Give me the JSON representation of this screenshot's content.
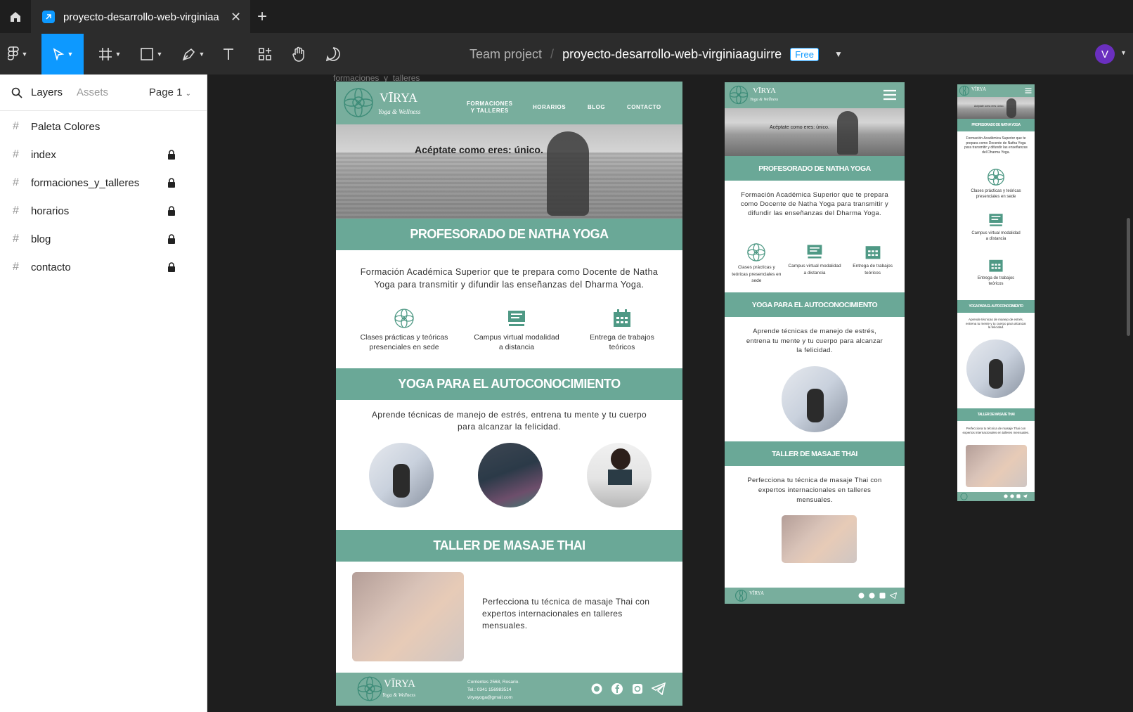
{
  "tabbar": {
    "tab_title": "proyecto-desarrollo-web-virginiaa",
    "close": "✕",
    "new_tab": "+"
  },
  "toolbar": {
    "team": "Team project",
    "separator": "/",
    "project": "proyecto-desarrollo-web-virginiaaguirre",
    "plan_badge": "Free",
    "avatar_letter": "V"
  },
  "left_panel": {
    "tabs": {
      "layers": "Layers",
      "assets": "Assets"
    },
    "page_selector": "Page 1",
    "layers": [
      {
        "name": "Paleta Colores",
        "locked": false
      },
      {
        "name": "index",
        "locked": true
      },
      {
        "name": "formaciones_y_talleres",
        "locked": true
      },
      {
        "name": "horarios",
        "locked": true
      },
      {
        "name": "blog",
        "locked": true
      },
      {
        "name": "contacto",
        "locked": true
      }
    ]
  },
  "canvas": {
    "frame_label": "formaciones_y_talleres",
    "desktop": {
      "brand": "VĪRYA",
      "brand_sub": "Yoga & Wellness",
      "nav": [
        "FORMACIONES\nY TALLERES",
        "HORARIOS",
        "BLOG",
        "CONTACTO"
      ],
      "hero_text": "Acéptate como eres: único.",
      "section1_title": "PROFESORADO DE NATHA YOGA",
      "section1_body": "Formación Académica Superior que te prepara como Docente de Natha Yoga para transmitir y difundir las enseñanzas del Dharma Yoga.",
      "features": [
        {
          "label": "Clases prácticas y teóricas presenciales en sede",
          "icon": "mandala-icon"
        },
        {
          "label": "Campus virtual modalidad a distancia",
          "icon": "monitor-icon"
        },
        {
          "label": "Entrega de trabajos teóricos",
          "icon": "calendar-icon"
        }
      ],
      "section2_title": "YOGA PARA EL AUTOCONOCIMIENTO",
      "section2_body": "Aprende técnicas de manejo de estrés, entrena tu mente y tu cuerpo para alcanzar la felicidad.",
      "section3_title": "TALLER DE MASAJE THAI",
      "section3_body": "Perfecciona tu técnica de masaje Thai con expertos internacionales en talleres mensuales.",
      "footer_address": "Corrientes 2568, Rosario.",
      "footer_phone": "Tel.: 0341 156983514",
      "footer_email": "viryayoga@gmail.com"
    },
    "tablet": {
      "hero_text": "Acéptate como eres: único.",
      "section1_title": "PROFESORADO DE NATHA YOGA",
      "section1_body": "Formación Académica Superior que te prepara como Docente de Natha Yoga para transmitir y difundir las enseñanzas del Dharma Yoga.",
      "features": [
        "Clases prácticas y teóricas presenciales en sede",
        "Campus virtual modalidad a distancia",
        "Entrega de trabajos teóricos"
      ],
      "section2_title": "YOGA PARA EL AUTOCONOCIMIENTO",
      "section2_body": "Aprende técnicas de manejo de estrés, entrena tu mente y tu cuerpo para alcanzar la felicidad.",
      "section3_title": "TALLER DE MASAJE THAI",
      "section3_body": "Perfecciona tu técnica de masaje Thai con expertos internacionales en talleres mensuales."
    },
    "mobile": {
      "hero_text": "Acéptate como eres: único.",
      "section1_title": "PROFESORADO DE NATHA YOGA",
      "section1_body": "Formación Académica Superior que te prepara como Docente de Natha Yoga para transmitir y difundir las enseñanzas del Dharma Yoga.",
      "features": [
        "Clases prácticas y teóricas presenciales en sede",
        "Campus virtual modalidad a distancia",
        "Entrega de trabajos teóricos"
      ],
      "section2_title": "YOGA PARA EL AUTOCONOCIMIENTO",
      "section2_body": "Aprende técnicas de manejo de estrés, entrena tu mente y tu cuerpo para alcanzar la felicidad.",
      "section3_title": "TALLER DE MASAJE THAI",
      "section3_body": "Perfecciona tu técnica de masaje Thai con expertos internacionales en talleres mensuales."
    }
  },
  "colors": {
    "accent": "#0d99ff",
    "brand_teal": "#6aa897",
    "ui_dark": "#2c2c2c"
  }
}
